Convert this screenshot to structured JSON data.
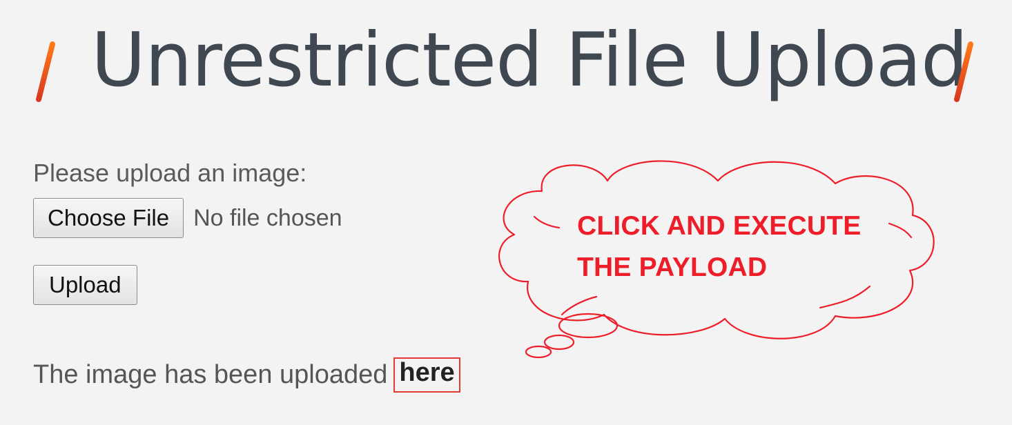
{
  "page": {
    "title": "Unrestricted File Upload",
    "accent_color": "#f05a28"
  },
  "form": {
    "label": "Please upload an image:",
    "choose_file_label": "Choose File",
    "file_status": "No file chosen",
    "upload_label": "Upload"
  },
  "result": {
    "text": "The image has been uploaded",
    "link_text": "here"
  },
  "annotation": {
    "line1": "CLICK AND EXECUTE",
    "line2": "THE PAYLOAD",
    "color": "#ee1d2a",
    "link_highlight_color": "#e53935"
  }
}
